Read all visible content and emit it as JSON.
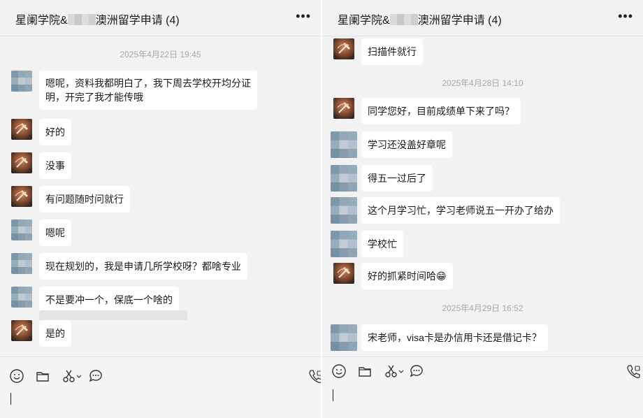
{
  "left": {
    "title_prefix": "星阑学院&",
    "title_suffix": "澳洲留学申请 (4)",
    "more": "•••",
    "timestamp": "2025年4月22日 19:45",
    "messages": [
      {
        "sender": "other",
        "lines": [
          "嗯呢，资料我都明白了，我下周去学校开均分证",
          "明，开完了我才能传哦"
        ]
      },
      {
        "sender": "teacher",
        "text": "好的"
      },
      {
        "sender": "teacher",
        "text": "没事"
      },
      {
        "sender": "teacher",
        "text": "有问题随时问就行"
      },
      {
        "sender": "other",
        "text": "嗯呢"
      },
      {
        "sender": "other",
        "text": "现在规划的，我是申请几所学校呀？都啥专业"
      },
      {
        "sender": "other",
        "text": "不是要冲一个，保底一个啥的"
      },
      {
        "sender": "teacher",
        "text": "是的"
      }
    ]
  },
  "right": {
    "title_prefix": "星阑学院&",
    "title_suffix": "澳洲留学申请 (4)",
    "more": "•••",
    "messages_top": [
      {
        "sender": "teacher",
        "text": "扫描件就行"
      }
    ],
    "timestamp1": "2025年4月28日 14:10",
    "messages_mid": [
      {
        "sender": "teacher",
        "text": "同学您好，目前成绩单下来了吗？"
      },
      {
        "sender": "other",
        "text": "学习还没盖好章呢"
      },
      {
        "sender": "other",
        "text": "得五一过后了"
      },
      {
        "sender": "other",
        "text": "这个月学习忙，学习老师说五一开办了给办"
      },
      {
        "sender": "other",
        "text": "学校忙"
      },
      {
        "sender": "teacher",
        "text": "好的抓紧时间哈😁"
      }
    ],
    "timestamp2": "2025年4月29日 16:52",
    "messages_bottom": [
      {
        "sender": "other",
        "text": "宋老师，visa卡是办信用卡还是借记卡？"
      }
    ]
  },
  "toolbar": {
    "icons": [
      "emoji-icon",
      "folder-icon",
      "scissors-icon",
      "chat-icon",
      "phone-icon"
    ]
  }
}
